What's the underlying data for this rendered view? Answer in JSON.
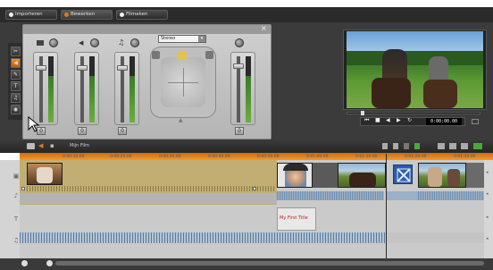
{
  "tabs": [
    {
      "label": "Importeren",
      "active": false
    },
    {
      "label": "Bewerken",
      "active": true
    },
    {
      "label": "Filmaken",
      "active": false
    }
  ],
  "mixer": {
    "channels": [
      {
        "icon": "camera-icon",
        "value": "0"
      },
      {
        "icon": "speaker-icon",
        "value": "0"
      },
      {
        "icon": "music-icon",
        "value": "0"
      }
    ],
    "master_value": "0",
    "surround_mode": "Stereo",
    "close_label": "×"
  },
  "side_tools": [
    "scissors-icon",
    "speaker-icon",
    "pen-icon",
    "title-icon",
    "music-icon",
    "dvd-icon"
  ],
  "preview": {
    "timecode": "0:00:00.00",
    "controls": [
      "jump-start",
      "prev-frame",
      "play",
      "next-frame",
      "loop"
    ]
  },
  "timeline": {
    "project_label": "Mijn Film",
    "ruler_labels": [
      "0:00:10.00",
      "0:00:20.00",
      "0:00:30.00",
      "0:00:40.00",
      "0:00:50.00",
      "0:01:00.00",
      "0:01:10.00",
      "0:01:20.00",
      "0:01:30.00"
    ],
    "title_clip_text": "My First Title"
  },
  "colors": {
    "accent": "#e07b16",
    "panel": "#3b3b3b",
    "timeline_bg": "#c8c8c8",
    "audio_clip": "#c0ab72"
  }
}
